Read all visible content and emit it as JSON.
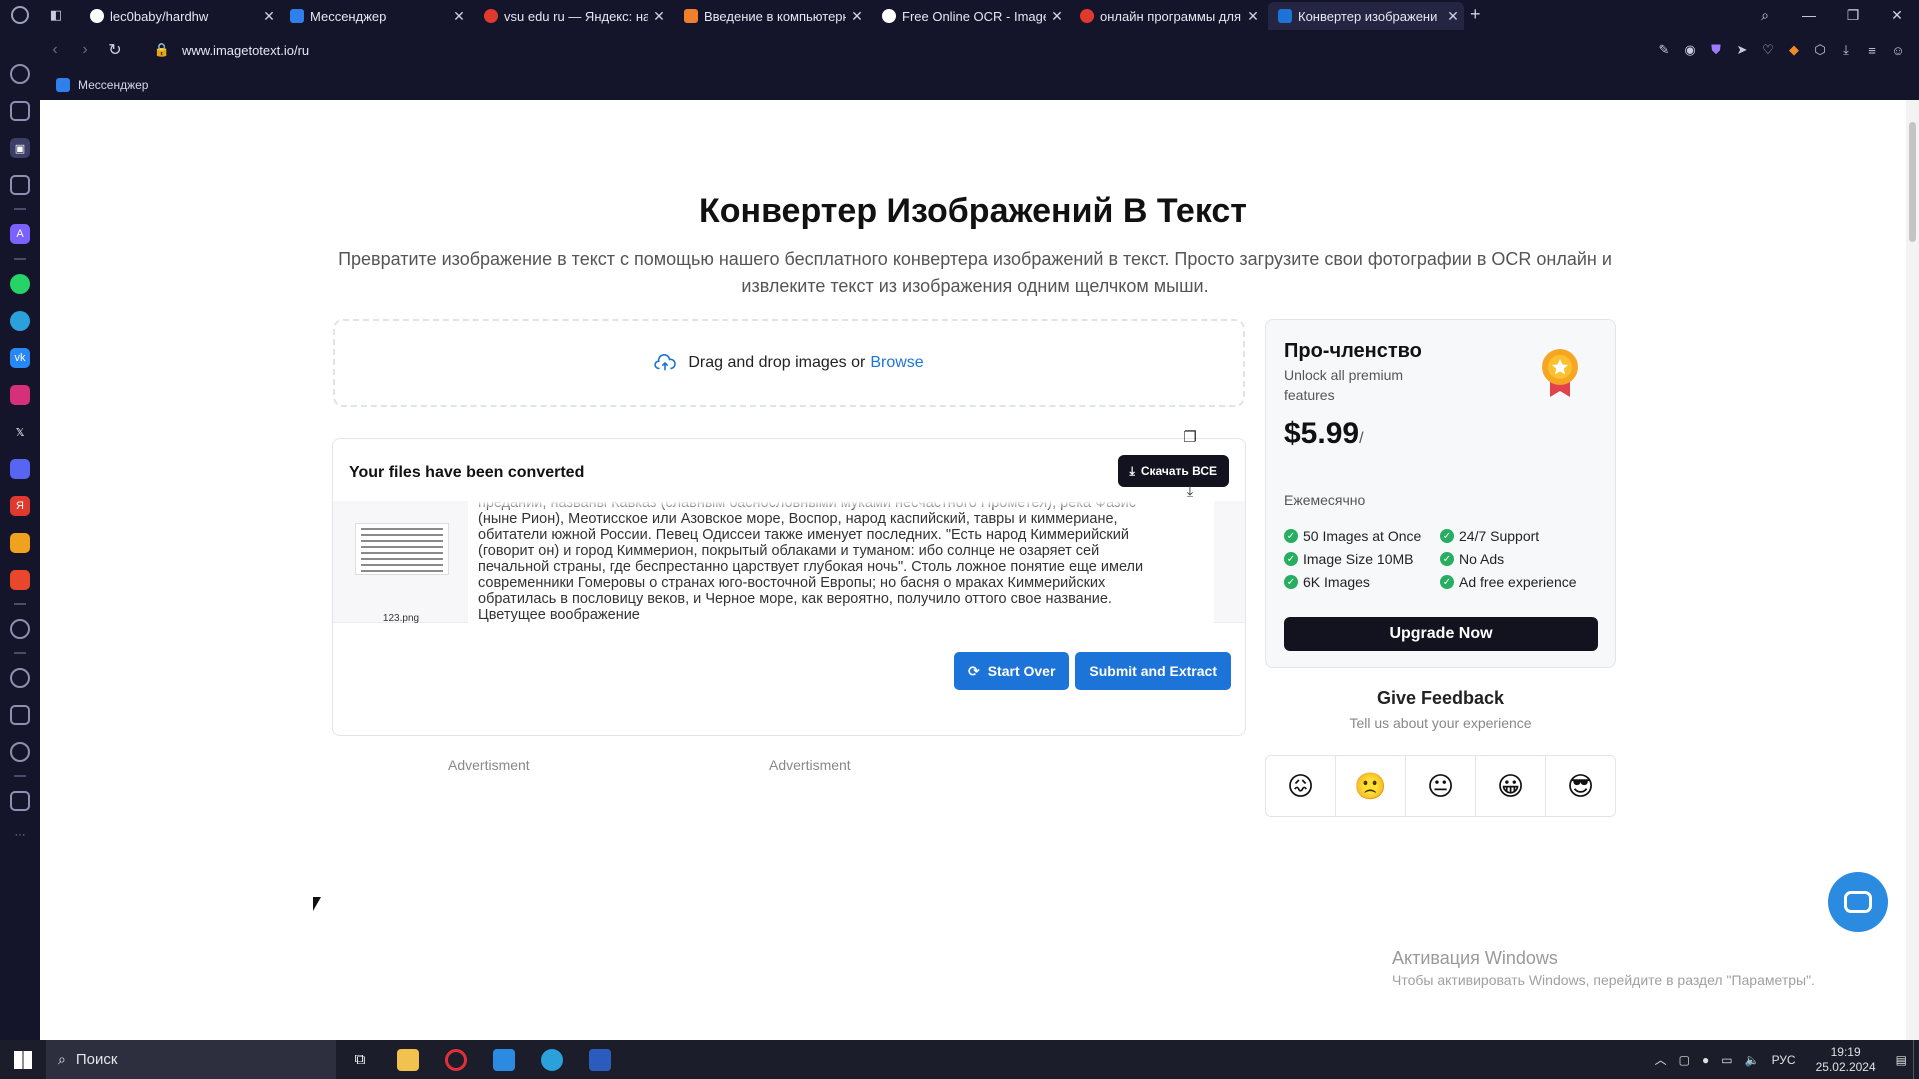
{
  "browser": {
    "tabs": [
      {
        "title": "lec0baby/hardhw"
      },
      {
        "title": "Мессенджер"
      },
      {
        "title": "vsu edu ru — Яндекс: наш"
      },
      {
        "title": "Введение в компьютерну"
      },
      {
        "title": "Free Online OCR - Image t"
      },
      {
        "title": "онлайн программы для р"
      },
      {
        "title": "Конвертер изображени"
      }
    ],
    "url": "www.imagetotext.io/ru",
    "bookmark": "Мессенджер"
  },
  "page": {
    "title": "Конвертер Изображений В Текст",
    "subtitle": "Превратите изображение в текст с помощью нашего бесплатного конвертера изображений в текст. Просто загрузите свои фотографии в OCR онлайн и извлеките текст из изображения одним щелчком мыши.",
    "dropzone_text": "Drag and drop images or",
    "browse": "Browse",
    "converted_heading": "Your files have been converted",
    "download_all": "Скачать ВСЕ",
    "file_name": "123.png",
    "extracted_text": "преданий, названы Кавказ (славным баснословными муками несчастного Прометея), река Фазис (ныне Рион), Меотисское или Азовское море, Воспор, народ каспийский, тавры и киммериане, обитатели южной России. Певец Одиссеи также именует последних. \"Есть народ Киммерийский (говорит он) и город Киммерион, покрытый облаками и туманом: ибо солнце не озаряет сей печальной страны, где беспрестанно царствует глубокая ночь\". Столь ложное понятие еще имели современники Гомеровы о странах юго-восточной Европы; но басня о мраках Киммерийских обратилась в пословицу веков, и Черное море, как вероятно, получило оттого свое название. Цветущее воображение",
    "start_over": "Start Over",
    "submit_extract": "Submit and Extract",
    "ad_left": "Advertisment",
    "ad_right": "Advertisment"
  },
  "pro": {
    "title": "Про-членство",
    "subtitle": "Unlock all premium features",
    "price": "$5.99",
    "price_suffix": "/",
    "period": "Ежемесячно",
    "features_left": [
      "50 Images at Once",
      "Image Size 10MB",
      "6K Images"
    ],
    "features_right": [
      "24/7 Support",
      "No Ads",
      "Ad free experience"
    ],
    "upgrade": "Upgrade Now"
  },
  "feedback": {
    "title": "Give Feedback",
    "subtitle": "Tell us about your experience",
    "emojis": [
      "😖",
      "🙁",
      "😐",
      "😀",
      "😎"
    ]
  },
  "windows": {
    "activation_title": "Активация Windows",
    "activation_sub": "Чтобы активировать Windows, перейдите в раздел \"Параметры\".",
    "search": "Поиск",
    "lang": "РУС",
    "time": "19:19",
    "date": "25.02.2024"
  },
  "colors": {
    "accent": "#1d74d8",
    "dark_button": "#12131e",
    "check": "#27ae60",
    "chrome": "#14152a"
  }
}
